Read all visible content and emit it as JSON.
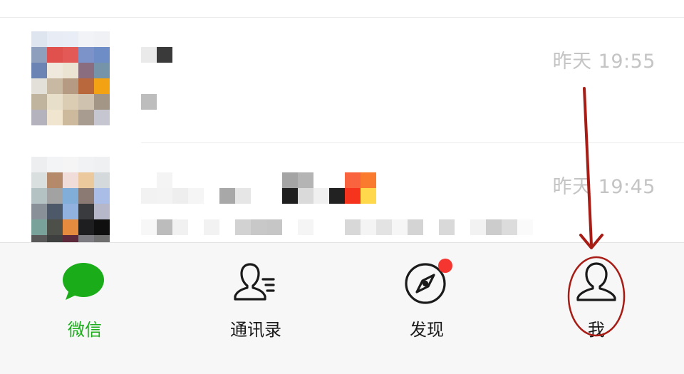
{
  "chats": [
    {
      "time": "昨天 19:55"
    },
    {
      "time": "昨天 19:45"
    }
  ],
  "tabs": [
    {
      "label": "微信",
      "icon": "chat-bubble-icon",
      "active": true
    },
    {
      "label": "通讯录",
      "icon": "contacts-icon"
    },
    {
      "label": "发现",
      "icon": "compass-icon",
      "badge": true
    },
    {
      "label": "我",
      "icon": "person-icon"
    }
  ],
  "colors": {
    "active": "#1aad19",
    "badge": "#f43530",
    "annotation": "#a71d16"
  }
}
